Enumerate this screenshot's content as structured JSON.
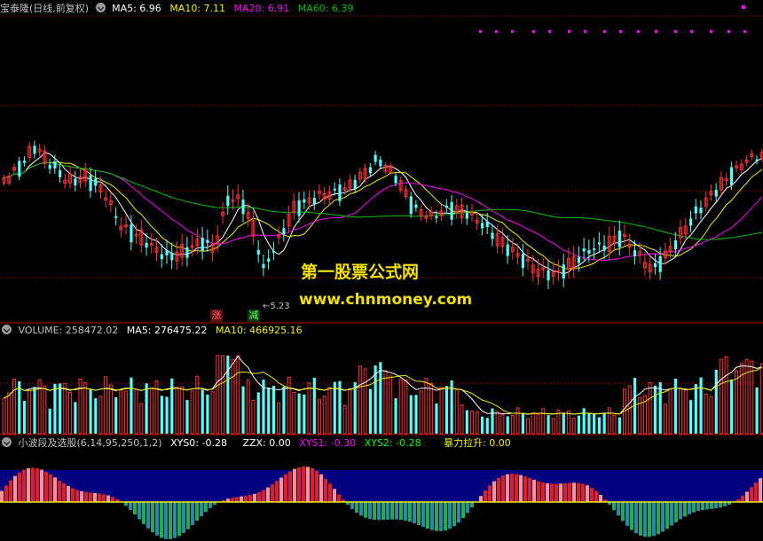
{
  "colors": {
    "background": "#000000",
    "grid": "#8b0000",
    "up": "#ff3232",
    "down": "#54fcfc",
    "ma5": "#ffffff",
    "ma10": "#f0f000",
    "ma20": "#ff00ff",
    "ma60": "#00c000",
    "volume_label": "#c0c0c0",
    "indicator_bg": "#000080",
    "watermark": "#f2e200"
  },
  "price_panel": {
    "title": "宝泰隆(日线,前复权)",
    "indicators": [
      {
        "label": "MA5: 6.96",
        "color": "#ffffff"
      },
      {
        "label": "MA10: 7.11",
        "color": "#f0f000"
      },
      {
        "label": "MA20: 6.91",
        "color": "#ff00ff"
      },
      {
        "label": "MA60: 6.39",
        "color": "#00c000"
      }
    ],
    "low_price_label": "5.23",
    "marker_up": "涨",
    "marker_down": "减"
  },
  "watermark": {
    "line1": "第一股票公式网",
    "line2": "www.chnmoney.com"
  },
  "volume_panel": {
    "title": "VOLUME: 258472.02",
    "indicators": [
      {
        "label": "MA5: 276475.22",
        "color": "#ffffff"
      },
      {
        "label": "MA10: 466925.16",
        "color": "#f0f000"
      }
    ]
  },
  "indicator_panel": {
    "title": "小波段及选股(6,14,95,250,1,2)",
    "indicators": [
      {
        "label": "XYS0: -0.28",
        "color": "#ffffff"
      },
      {
        "label": "ZZX: 0.00",
        "color": "#ffffff"
      },
      {
        "label": "XYS1: -0.30",
        "color": "#ff00ff"
      },
      {
        "label": "XYS2: -0.28",
        "color": "#00ff00"
      },
      {
        "label": "暴力拉升: 0.00",
        "color": "#f0f000"
      }
    ]
  }
}
